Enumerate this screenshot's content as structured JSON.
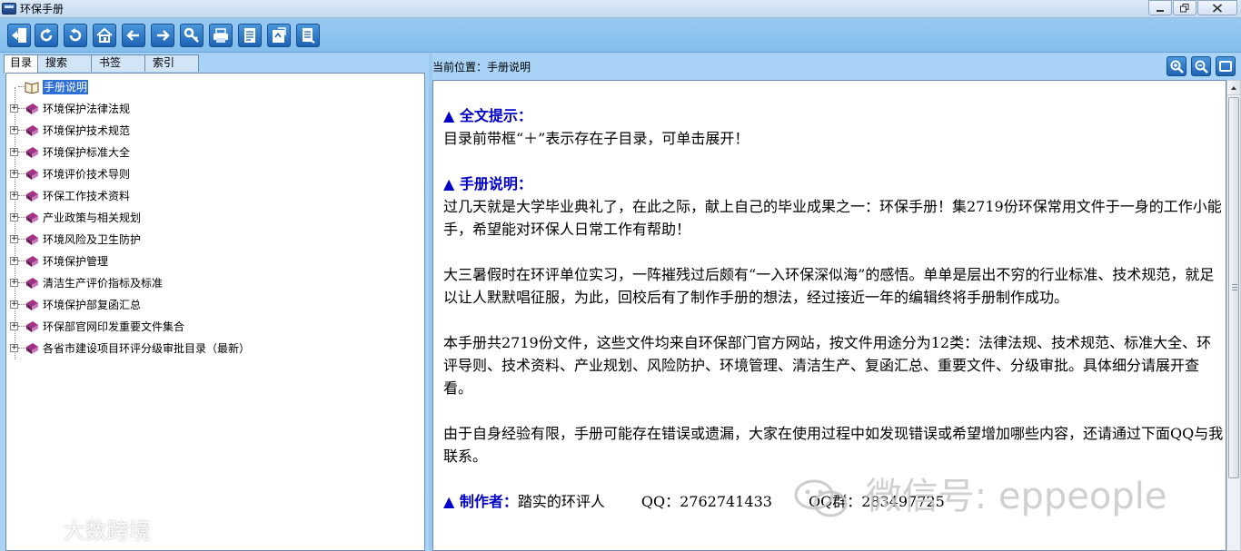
{
  "window": {
    "title": "环保手册"
  },
  "toolbar": {
    "buttons": [
      "exit-icon",
      "refresh-icon",
      "undo-icon",
      "home-icon",
      "back-arrow-icon",
      "forward-arrow-icon",
      "search-key-icon",
      "print-icon",
      "note-icon",
      "bookmark-add-icon",
      "list-icon"
    ]
  },
  "left": {
    "tabs": [
      "目录",
      "搜索",
      "书签",
      "索引"
    ],
    "tree": [
      "手册说明",
      "环境保护法律法规",
      "环境保护技术规范",
      "环境保护标准大全",
      "环境评价技术导则",
      "环保工作技术资料",
      "产业政策与相关规划",
      "环境风险及卫生防护",
      "环境保护管理",
      "清洁生产评价指标及标准",
      "环境保护部复函汇总",
      "环保部官网印发重要文件集合",
      "各省市建设项目环评分级审批目录（最新）"
    ]
  },
  "right": {
    "location": "当前位置：手册说明",
    "doc": {
      "h1": "▲ 全文提示：",
      "p1": "目录前带框“＋”表示存在子目录，可单击展开！",
      "h2": "▲ 手册说明：",
      "p2": "过几天就是大学毕业典礼了，在此之际，献上自己的毕业成果之一：环保手册！集2719份环保常用文件于一身的工作小能手，希望能对环保人日常工作有帮助！",
      "p3": "大三暑假时在环评单位实习，一阵摧残过后颇有“一入环保深似海”的感悟。单单是层出不穷的行业标准、技术规范，就足以让人默默唱征服，为此，回校后有了制作手册的想法，经过接近一年的编辑终将手册制作成功。",
      "p4": "本手册共2719份文件，这些文件均来自环保部门官方网站，按文件用途分为12类：法律法规、技术规范、标准大全、环评导则、技术资料、产业规划、风险防护、环境管理、清洁生产、复函汇总、重要文件、分级审批。具体细分请展开查看。",
      "p5": "由于自身经验有限，手册可能存在错误或遗漏，大家在使用过程中如发现错误或希望增加哪些内容，还请通过下面QQ与我联系。",
      "h3": "▲ 制作者：",
      "author": "踏实的环评人",
      "qq": "QQ：2762741433",
      "qqgroup": "QQ群：283497725"
    }
  },
  "watermarks": {
    "left": "大数跨境",
    "right": "微信号: eppeople"
  }
}
